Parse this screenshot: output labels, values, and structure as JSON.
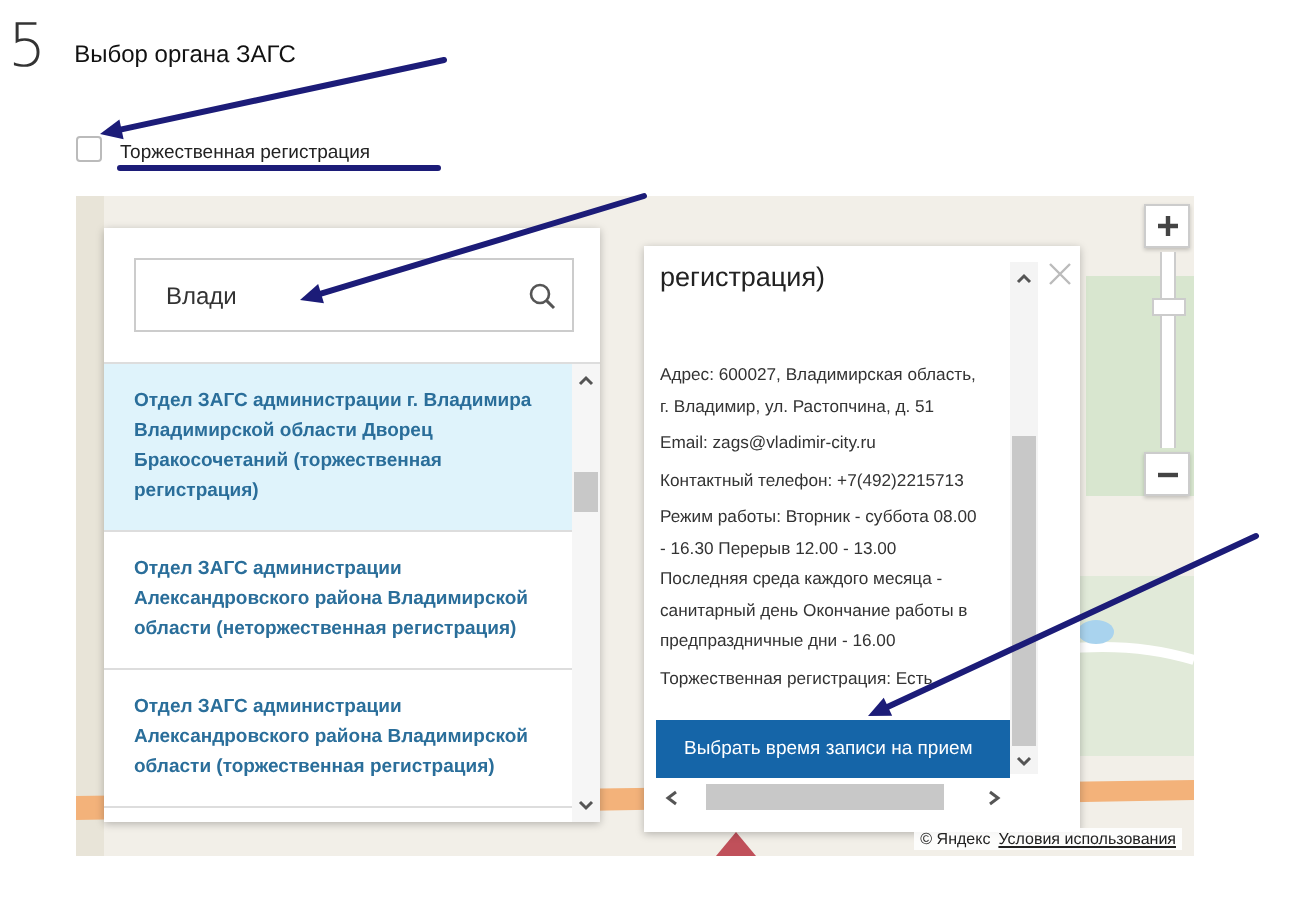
{
  "step": {
    "number": "5",
    "title": "Выбор органа ЗАГС"
  },
  "filter": {
    "label": "Торжественная регистрация",
    "checked": false
  },
  "search": {
    "value": "Влади"
  },
  "results": [
    {
      "name": "Отдел ЗАГС администрации г. Владимира Владимирской области Дворец Бракосочетаний (торжественная регистрация)",
      "selected": true
    },
    {
      "name": "Отдел ЗАГС администрации Александровского района Владимирской области (неторжественная регистрация)",
      "selected": false
    },
    {
      "name": "Отдел ЗАГС администрации Александровского района Владимирской области (торжественная регистрация)",
      "selected": false
    }
  ],
  "info": {
    "heading": "регистрация)",
    "lines": [
      "Адрес: 600027, Владимирская область, г. Владимир, ул. Растопчина, д. 51",
      "Email: zags@vladimir-city.ru",
      "Контактный телефон: +7(492)2215713",
      "Режим работы: Вторник - суббота 08.00 - 16.30 Перерыв 12.00 - 13.00 Последняя среда каждого месяца - санитарный день Окончание работы в предпраздничные дни - 16.00",
      "Торжественная регистрация: Есть"
    ],
    "button": "Выбрать время записи на прием"
  },
  "zoom": {
    "level": 0.74
  },
  "attribution": {
    "copyright": "© Яндекс",
    "terms": "Условия использования"
  }
}
